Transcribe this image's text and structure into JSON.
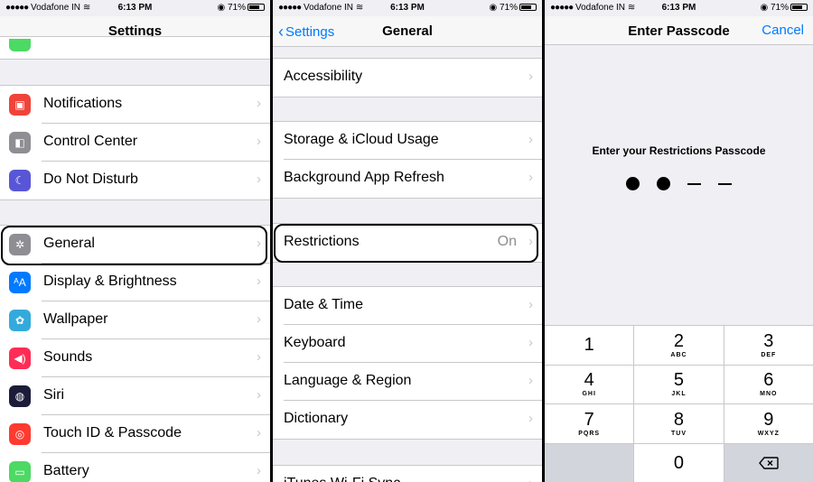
{
  "panel1": {
    "status": {
      "carrier": "Vodafone IN",
      "time": "6:13 PM",
      "battery": "71%"
    },
    "title": "Settings",
    "groups": [
      [
        {
          "label": "Notifications",
          "icon": "notifications-icon",
          "color": "#f0433a"
        },
        {
          "label": "Control Center",
          "icon": "control-center-icon",
          "color": "#8e8e93"
        },
        {
          "label": "Do Not Disturb",
          "icon": "moon-icon",
          "color": "#5856d6"
        }
      ],
      [
        {
          "label": "General",
          "icon": "gear-icon",
          "color": "#8e8e93"
        },
        {
          "label": "Display & Brightness",
          "icon": "display-icon",
          "color": "#007aff"
        },
        {
          "label": "Wallpaper",
          "icon": "wallpaper-icon",
          "color": "#34aadc"
        },
        {
          "label": "Sounds",
          "icon": "speaker-icon",
          "color": "#ff2d55"
        },
        {
          "label": "Siri",
          "icon": "siri-icon",
          "color": "#1c1c3a"
        },
        {
          "label": "Touch ID & Passcode",
          "icon": "fingerprint-icon",
          "color": "#ff3b30"
        },
        {
          "label": "Battery",
          "icon": "battery-icon",
          "color": "#4cd964"
        }
      ]
    ]
  },
  "panel2": {
    "status": {
      "carrier": "Vodafone IN",
      "time": "6:13 PM",
      "battery": "71%"
    },
    "back": "Settings",
    "title": "General",
    "groups": [
      [
        {
          "label": "Accessibility"
        }
      ],
      [
        {
          "label": "Storage & iCloud Usage"
        },
        {
          "label": "Background App Refresh"
        }
      ],
      [
        {
          "label": "Restrictions",
          "value": "On"
        }
      ],
      [
        {
          "label": "Date & Time"
        },
        {
          "label": "Keyboard"
        },
        {
          "label": "Language & Region"
        },
        {
          "label": "Dictionary"
        }
      ],
      [
        {
          "label": "iTunes Wi-Fi Sync"
        }
      ]
    ]
  },
  "panel3": {
    "status": {
      "carrier": "Vodafone IN",
      "time": "6:13 PM",
      "battery": "71%"
    },
    "title": "Enter Passcode",
    "cancel": "Cancel",
    "prompt": "Enter your Restrictions Passcode",
    "entered": 2,
    "length": 4,
    "keys": [
      {
        "num": "1",
        "letters": ""
      },
      {
        "num": "2",
        "letters": "ABC"
      },
      {
        "num": "3",
        "letters": "DEF"
      },
      {
        "num": "4",
        "letters": "GHI"
      },
      {
        "num": "5",
        "letters": "JKL"
      },
      {
        "num": "6",
        "letters": "MNO"
      },
      {
        "num": "7",
        "letters": "PQRS"
      },
      {
        "num": "8",
        "letters": "TUV"
      },
      {
        "num": "9",
        "letters": "WXYZ"
      },
      {
        "num": "",
        "letters": ""
      },
      {
        "num": "0",
        "letters": ""
      },
      {
        "num": "delete",
        "letters": ""
      }
    ]
  }
}
